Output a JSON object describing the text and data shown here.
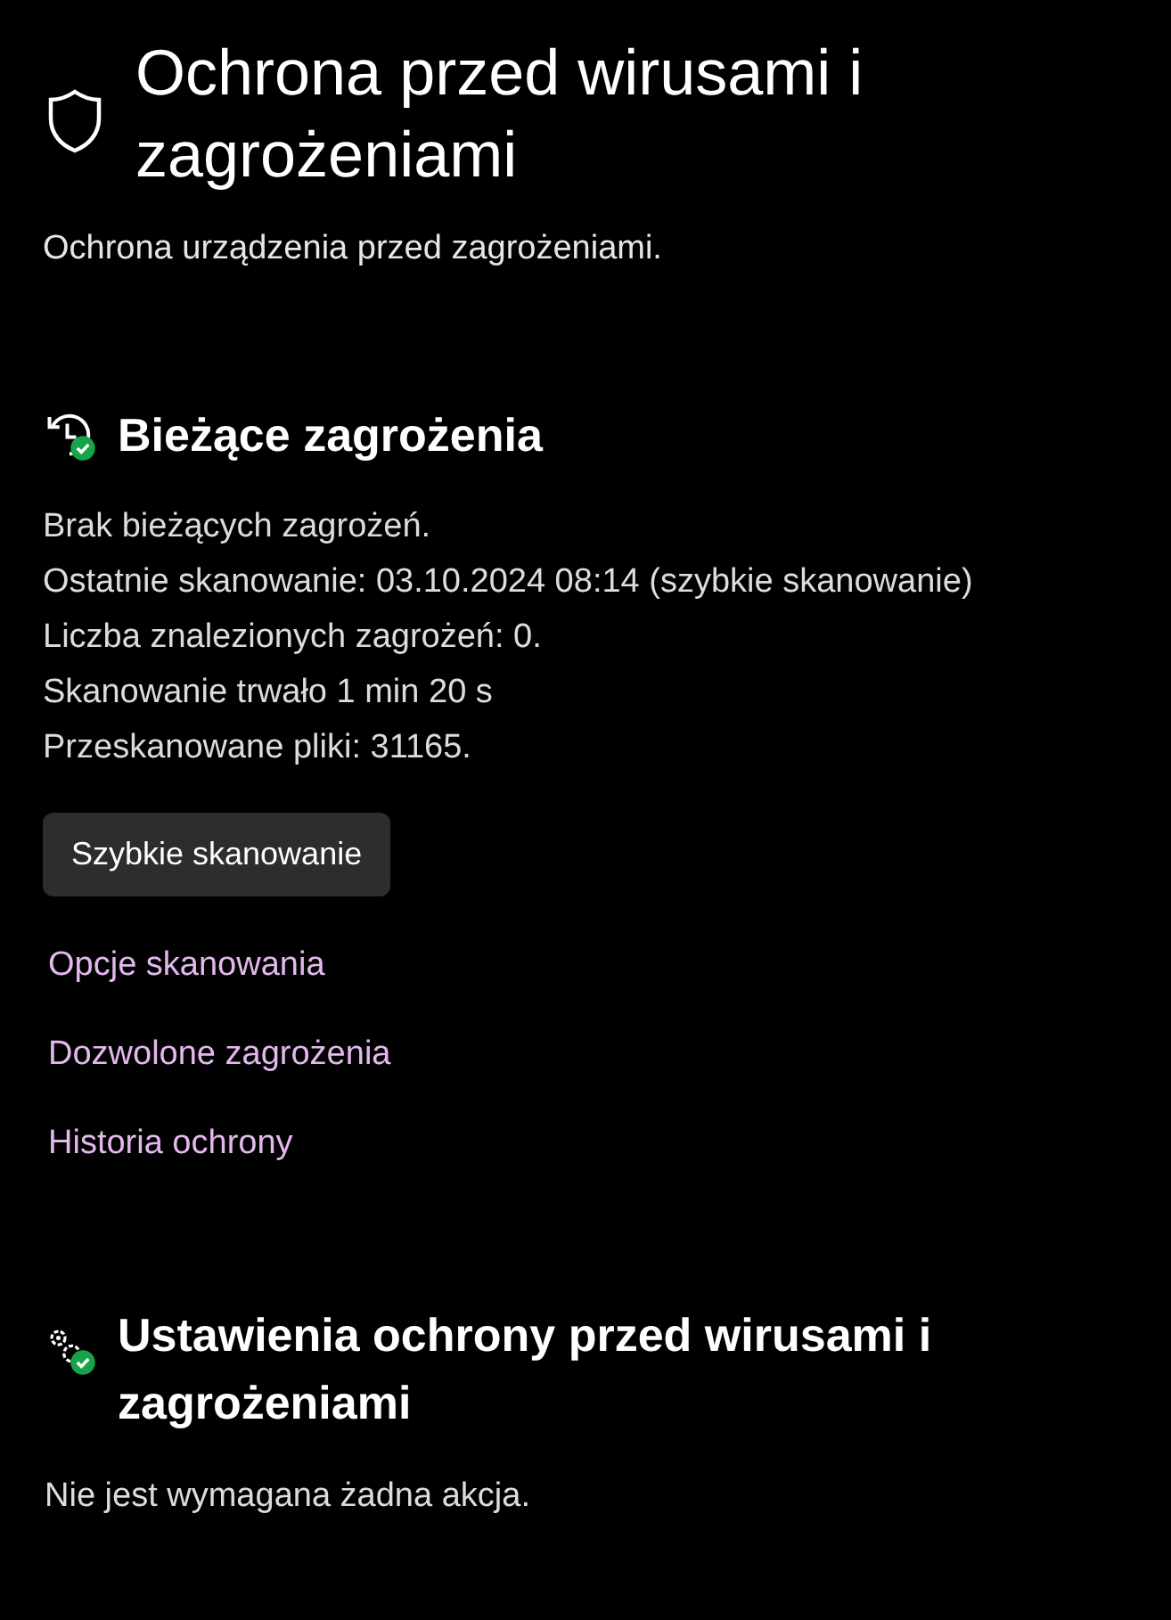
{
  "page": {
    "title": "Ochrona przed wirusami i zagrożeniami",
    "description": "Ochrona urządzenia przed zagrożeniami."
  },
  "current_threats": {
    "heading": "Bieżące zagrożenia",
    "lines": [
      "Brak bieżących zagrożeń.",
      "Ostatnie skanowanie: 03.10.2024 08:14 (szybkie skanowanie)",
      "Liczba znalezionych zagrożeń: 0.",
      "Skanowanie trwało 1 min 20 s",
      "Przeskanowane pliki: 31165."
    ],
    "button": "Szybkie skanowanie",
    "links": [
      "Opcje skanowania",
      "Dozwolone zagrożenia",
      "Historia ochrony"
    ]
  },
  "settings": {
    "heading": "Ustawienia ochrony przed wirusami i zagrożeniami",
    "status": "Nie jest wymagana żadna akcja."
  }
}
